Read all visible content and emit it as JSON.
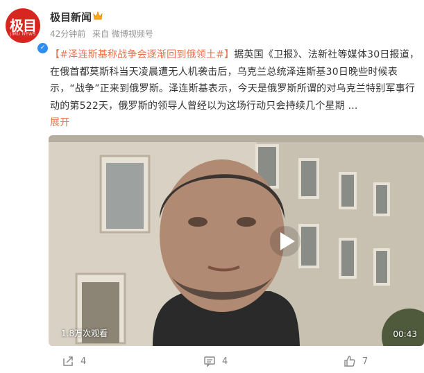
{
  "author": {
    "avatar_text": "极目",
    "avatar_sub": "JIMU NEWS",
    "name": "极目新闻",
    "crown_icon": "crown-icon",
    "verified_icon": "verified-badge-icon",
    "verified_glyph": "✓"
  },
  "meta": {
    "time": "42分钟前",
    "source": "来自 微博视频号"
  },
  "post": {
    "bracket_open": "【",
    "hashtag": "#泽连斯基称战争会逐渐回到俄领土#",
    "bracket_close": "】",
    "body": "据英国《卫报》、法新社等媒体30日报道，在俄首都莫斯科当天凌晨遭无人机袭击后，乌克兰总统泽连斯基30日晚些时候表示，“战争”正来到俄罗斯。泽连斯基表示，今天是俄罗斯所谓的对乌克兰特别军事行动的第522天，俄罗斯的领导人曾经以为这场行动只会持续几个星期 ...",
    "expand_label": "展开"
  },
  "video": {
    "views": "1.8万次观看",
    "duration": "00:43",
    "play_icon": "play-icon"
  },
  "actions": {
    "share_count": "4",
    "comment_count": "4",
    "like_count": "7"
  },
  "colors": {
    "accent": "#eb7350",
    "brand_red": "#d7261f",
    "verified_blue": "#2f8ef0"
  }
}
